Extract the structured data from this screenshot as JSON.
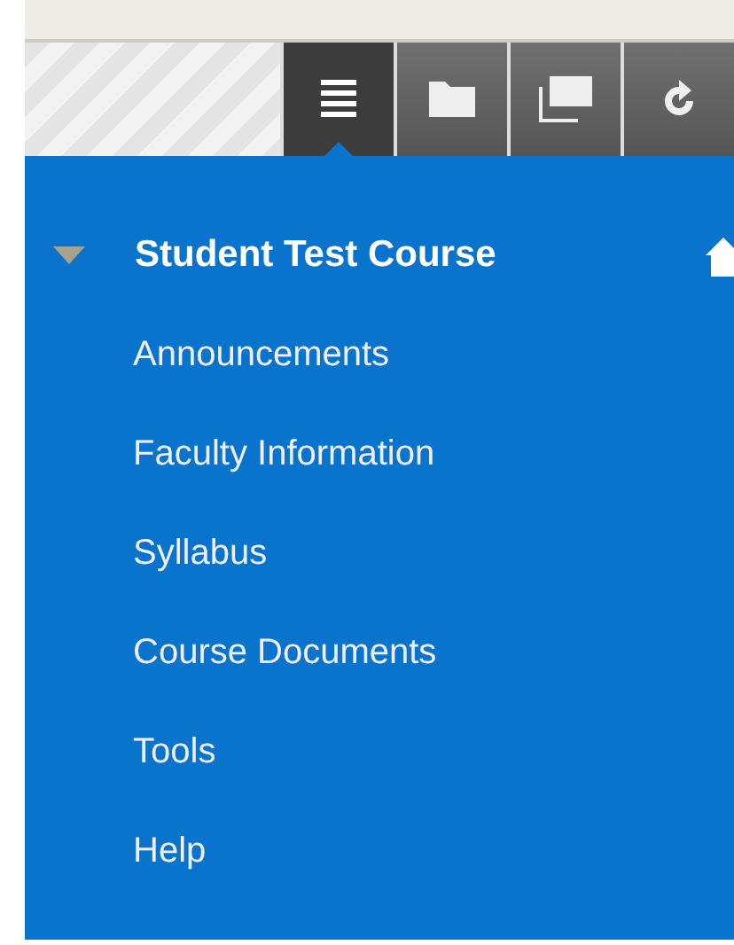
{
  "toolbar": {
    "tabs": [
      {
        "kind": "menu",
        "selected": true
      },
      {
        "kind": "folder",
        "selected": false
      },
      {
        "kind": "windows",
        "selected": false
      },
      {
        "kind": "refresh",
        "selected": false
      }
    ]
  },
  "course_menu": {
    "title": "Student Test Course",
    "expanded": true,
    "items": [
      "Announcements",
      "Faculty Information",
      "Syllabus",
      "Course Documents",
      "Tools",
      "Help"
    ]
  }
}
